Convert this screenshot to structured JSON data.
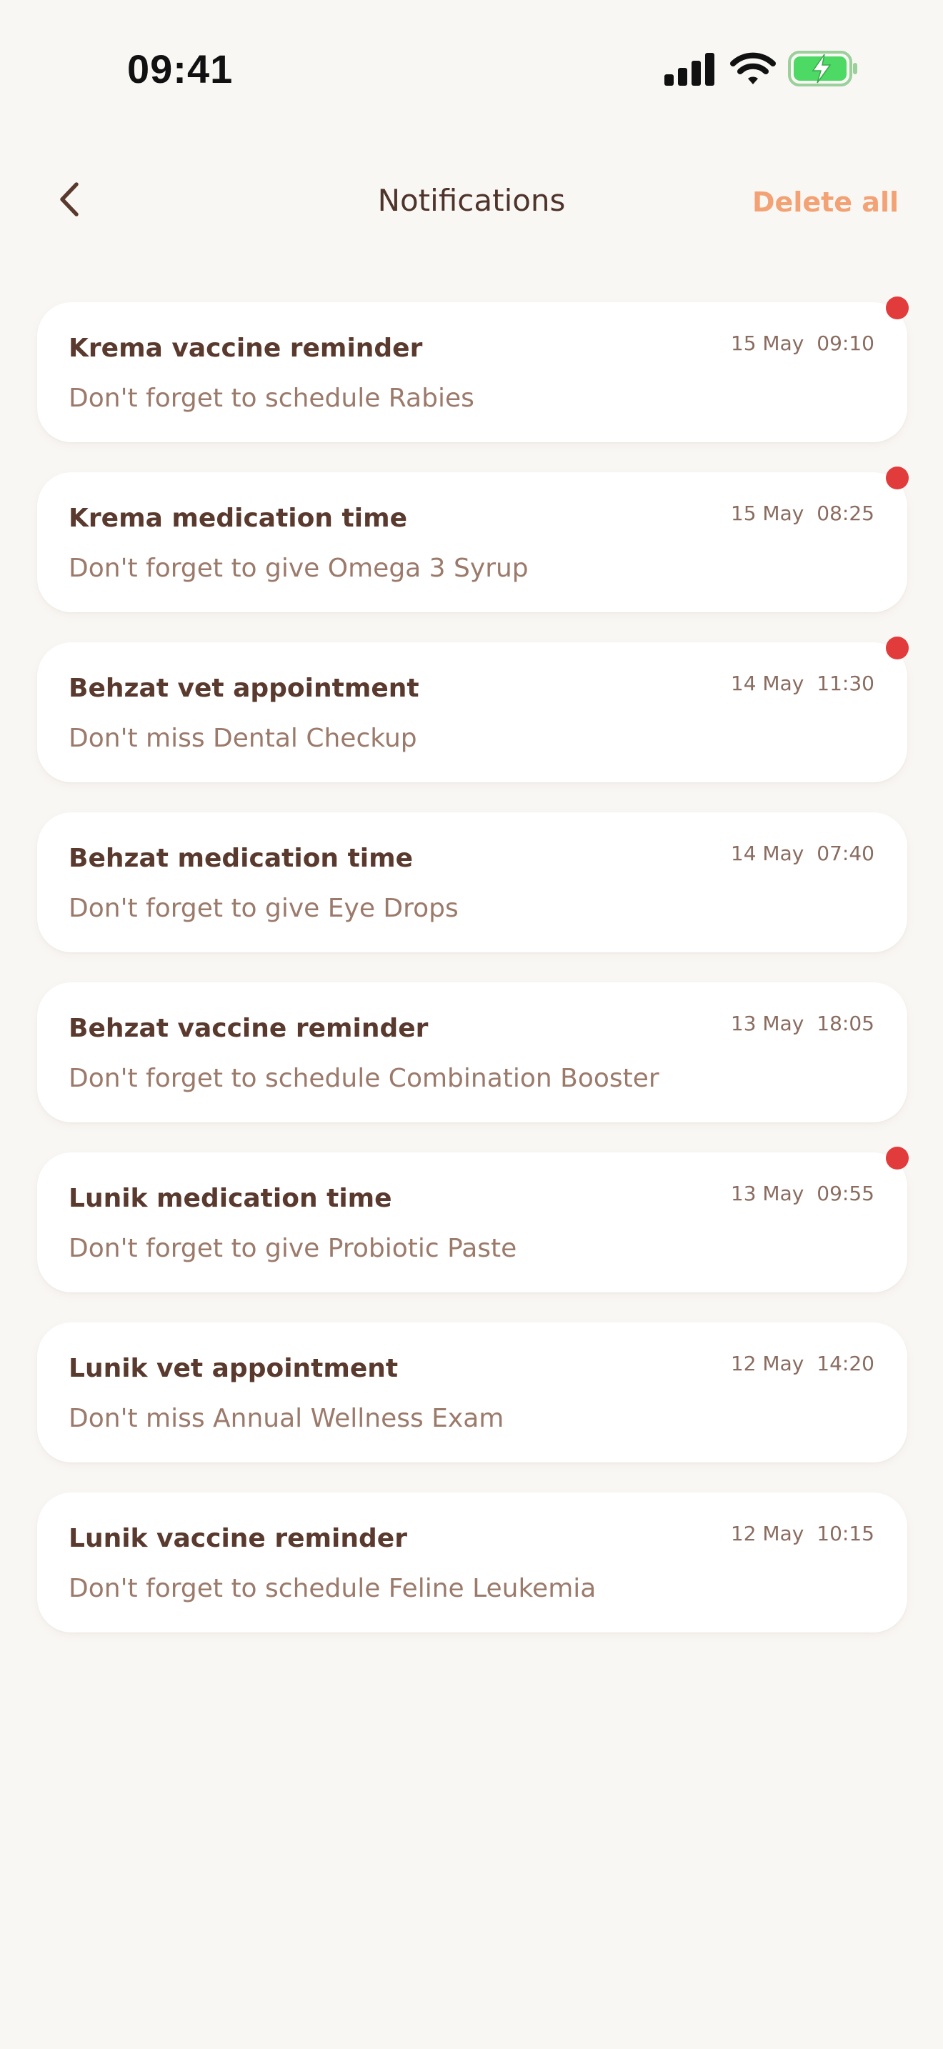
{
  "status_bar": {
    "time": "09:41",
    "icons": [
      "signal-icon",
      "wifi-icon",
      "battery-charging-icon"
    ]
  },
  "header": {
    "back_icon": "chevron-left-icon",
    "title": "Notifications",
    "delete_all_label": "Delete all"
  },
  "colors": {
    "background": "#f9f7f4",
    "text_primary": "#5a3a2e",
    "text_secondary": "#9b7a6b",
    "accent": "#f2a274",
    "unread_dot": "#e23b3b",
    "battery": "#4cd964"
  },
  "notifications": [
    {
      "title": "Krema vaccine reminder",
      "body": "Don't forget to schedule Rabies",
      "date": "15 May",
      "time": "09:10",
      "unread": true
    },
    {
      "title": "Krema medication time",
      "body": "Don't forget to give Omega 3 Syrup",
      "date": "15 May",
      "time": "08:25",
      "unread": true
    },
    {
      "title": "Behzat vet appointment",
      "body": "Don't miss Dental Checkup",
      "date": "14 May",
      "time": "11:30",
      "unread": true
    },
    {
      "title": "Behzat medication time",
      "body": "Don't forget to give Eye Drops",
      "date": "14 May",
      "time": "07:40",
      "unread": false
    },
    {
      "title": "Behzat vaccine reminder",
      "body": "Don't forget to schedule Combination Booster",
      "date": "13 May",
      "time": "18:05",
      "unread": false
    },
    {
      "title": "Lunik medication time",
      "body": "Don't forget to give Probiotic Paste",
      "date": "13 May",
      "time": "09:55",
      "unread": true
    },
    {
      "title": "Lunik vet appointment",
      "body": "Don't miss Annual Wellness Exam",
      "date": "12 May",
      "time": "14:20",
      "unread": false
    },
    {
      "title": "Lunik vaccine reminder",
      "body": "Don't forget to schedule Feline Leukemia",
      "date": "12 May",
      "time": "10:15",
      "unread": false
    }
  ]
}
